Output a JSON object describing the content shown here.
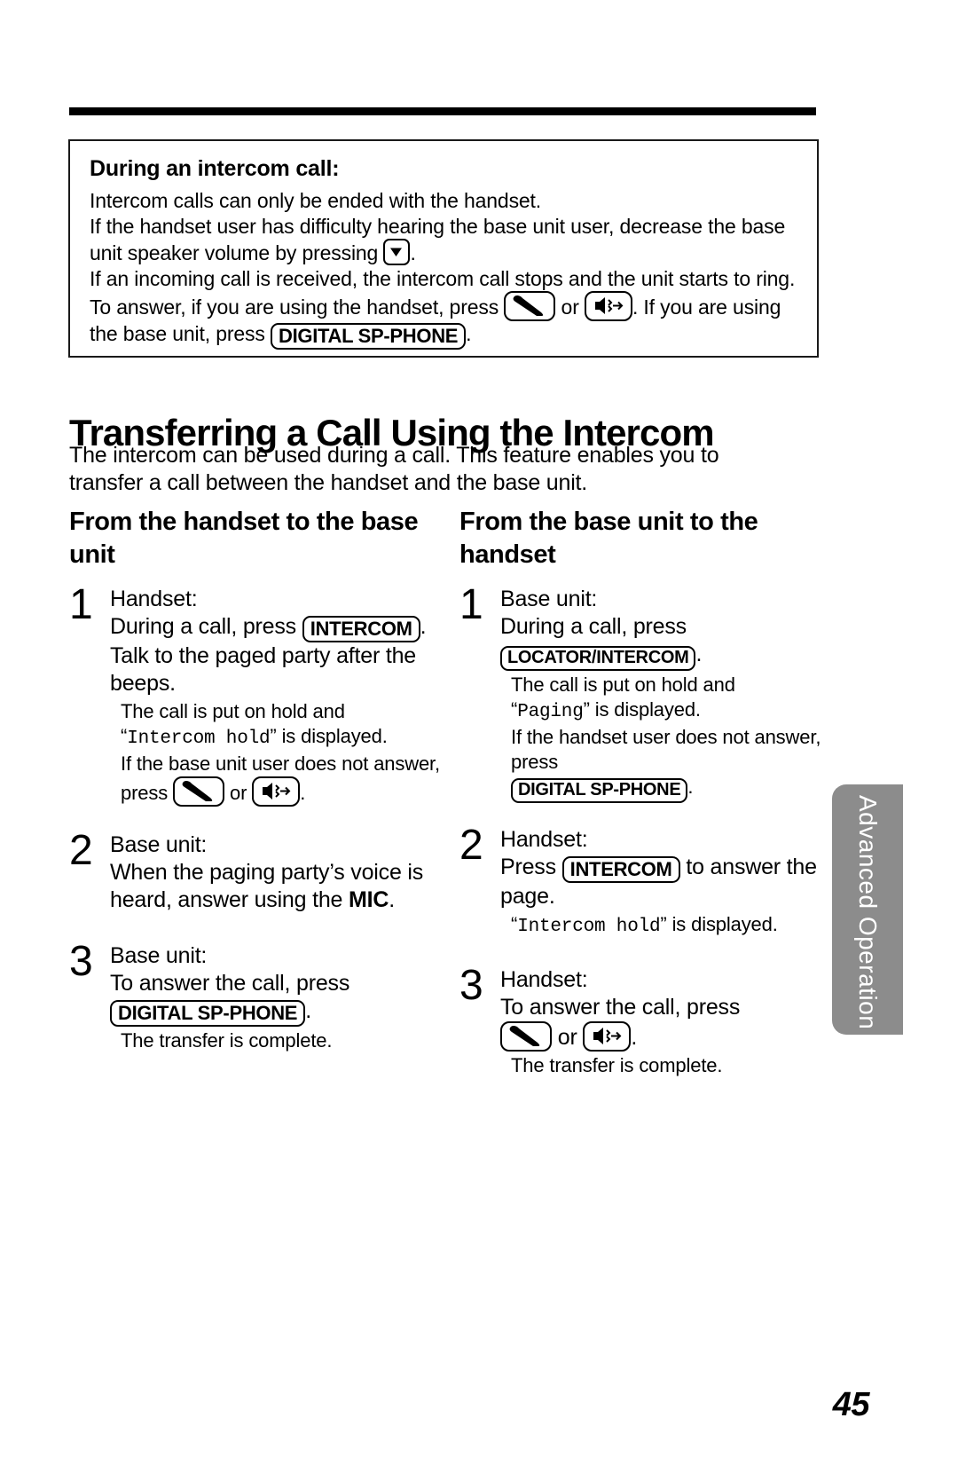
{
  "document": {
    "page_number": "45",
    "side_tab_label": "Advanced Operation"
  },
  "note_box": {
    "title": "During an intercom call:",
    "line1": "Intercom calls can only be ended with the handset.",
    "line2_a": "If the handset user has difficulty hearing the base unit user, decrease the base unit speaker volume by pressing",
    "line2_b": ".",
    "line3_a": "If an incoming call is received, the intercom call stops and the unit starts to ring. To answer, if you are using the handset, press",
    "line3_or": "or",
    "line3_b": ". If you are using the base unit, press",
    "line3_key": "DIGITAL SP-PHONE",
    "line3_c": "."
  },
  "heading": "Transferring a Call Using the Intercom",
  "intro": "The intercom can be used during a call. This feature enables you to transfer a call between the handset and the base unit.",
  "left_column": {
    "heading": "From the handset to the base unit",
    "steps": [
      {
        "num": "1",
        "who": "Handset:",
        "text_a": "During a call, press",
        "key": "INTERCOM",
        "text_b": ". Talk to the paged party after the beeps.",
        "sub_line1": "The call is put on hold and",
        "sub_quote_open": "“",
        "sub_mono": "Intercom hold",
        "sub_quote_close": "”",
        "sub_line2": " is displayed.",
        "sub_line3": "If the base unit user does not answer, press",
        "sub_or": "or",
        "sub_end": "."
      },
      {
        "num": "2",
        "who": "Base unit:",
        "text_a": "When the paging party’s voice is heard, answer using the",
        "bold": "MIC",
        "text_b": "."
      },
      {
        "num": "3",
        "who": "Base unit:",
        "text_a": "To answer the call, press",
        "key": "DIGITAL SP-PHONE",
        "text_b": ".",
        "sub_line1": "The transfer is complete."
      }
    ]
  },
  "right_column": {
    "heading": "From the base unit to the handset",
    "steps": [
      {
        "num": "1",
        "who": "Base unit:",
        "text_a": "During a call, press",
        "key": "LOCATOR/INTERCOM",
        "text_b": ".",
        "sub_line1": "The call is put on hold and",
        "sub_quote_open": "“",
        "sub_mono": "Paging",
        "sub_quote_close": "”",
        "sub_line2": " is displayed.",
        "sub_line3": "If the handset user does not answer, press",
        "sub_key": "DIGITAL SP-PHONE",
        "sub_end": "."
      },
      {
        "num": "2",
        "who": "Handset:",
        "text_a": "Press",
        "key": "INTERCOM",
        "text_b": "to answer the page.",
        "sub_quote_open": "“",
        "sub_mono": "Intercom hold",
        "sub_quote_close": "”",
        "sub_line2": " is displayed."
      },
      {
        "num": "3",
        "who": "Handset:",
        "text_a": "To answer the call, press",
        "sub_or": "or",
        "text_b": ".",
        "sub_line1": "The transfer is complete."
      }
    ]
  },
  "icons": {
    "volume_down": "volume-down-key-icon",
    "talk": "talk-handset-key-icon",
    "speakerphone": "speakerphone-key-icon"
  },
  "colors": {
    "text": "#000000",
    "side_tab_bg": "#8c8c8c",
    "side_tab_text": "#ffffff"
  }
}
